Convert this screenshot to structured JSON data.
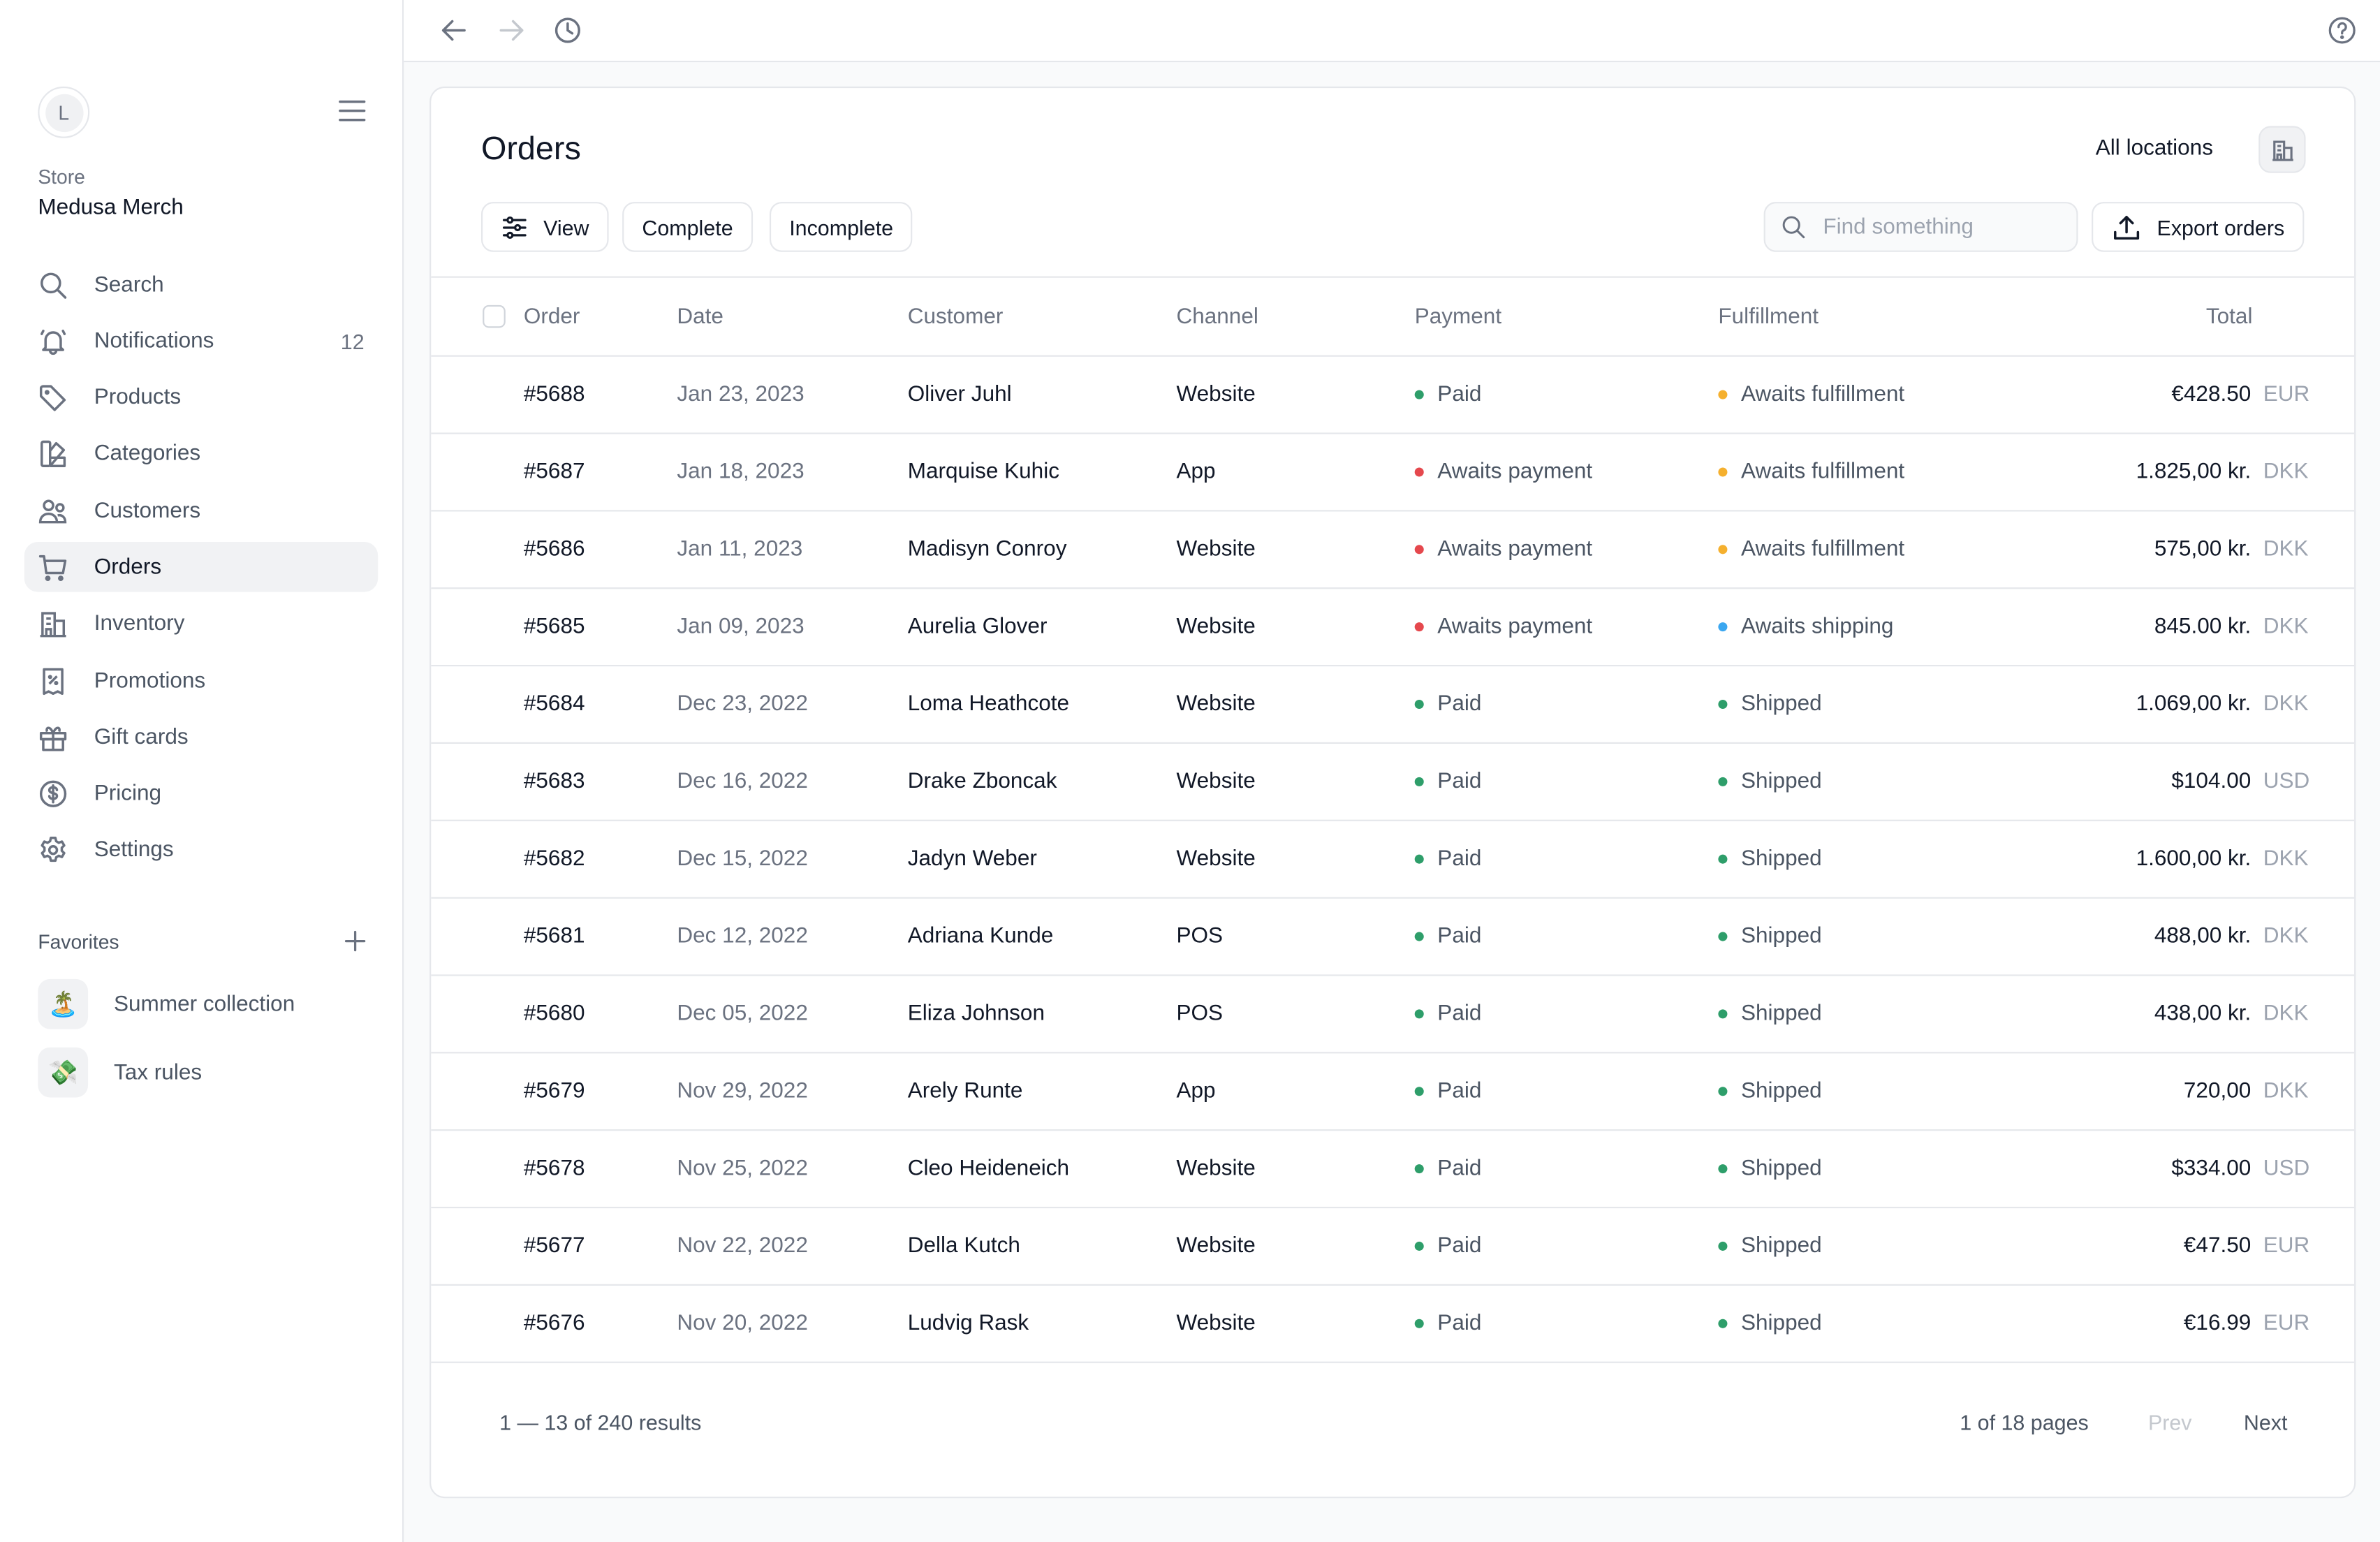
{
  "sidebar": {
    "avatar_initial": "L",
    "store_label": "Store",
    "store_name": "Medusa Merch",
    "items": [
      {
        "label": "Search",
        "icon": "search-icon"
      },
      {
        "label": "Notifications",
        "icon": "bell-icon",
        "count": "12"
      },
      {
        "label": "Products",
        "icon": "tag-icon"
      },
      {
        "label": "Categories",
        "icon": "swatch-icon"
      },
      {
        "label": "Customers",
        "icon": "users-icon"
      },
      {
        "label": "Orders",
        "icon": "cart-icon",
        "active": true
      },
      {
        "label": "Inventory",
        "icon": "building-icon"
      },
      {
        "label": "Promotions",
        "icon": "receipt-percent-icon"
      },
      {
        "label": "Gift cards",
        "icon": "gift-icon"
      },
      {
        "label": "Pricing",
        "icon": "dollar-circle-icon"
      },
      {
        "label": "Settings",
        "icon": "gear-icon"
      }
    ],
    "favorites_label": "Favorites",
    "favorites": [
      {
        "label": "Summer collection",
        "emoji": "🏝️"
      },
      {
        "label": "Tax rules",
        "emoji": "💸"
      }
    ]
  },
  "topbar": {
    "back_icon": "arrow-left-icon",
    "forward_icon": "arrow-right-icon",
    "history_icon": "clock-icon",
    "help_icon": "help-circle-icon"
  },
  "page": {
    "title": "Orders",
    "location_label": "All locations",
    "view_label": "View",
    "filter_complete": "Complete",
    "filter_incomplete": "Incomplete",
    "search_placeholder": "Find something",
    "search_value": "",
    "export_label": "Export orders"
  },
  "colors": {
    "paid": "#2e9e6a",
    "awaits_payment": "#e5484d",
    "awaits_fulfillment": "#f5b02e",
    "awaits_shipping": "#3ba7f0",
    "shipped": "#2e9e6a"
  },
  "table": {
    "columns": [
      "Order",
      "Date",
      "Customer",
      "Channel",
      "Payment",
      "Fulfillment",
      "Total"
    ],
    "rows": [
      {
        "order": "#5688",
        "date": "Jan 23, 2023",
        "customer": "Oliver Juhl",
        "channel": "Website",
        "payment": "Paid",
        "payment_color": "#2e9e6a",
        "fulfillment": "Awaits fulfillment",
        "fulfillment_color": "#f5b02e",
        "amount": "€428.50",
        "currency": "EUR"
      },
      {
        "order": "#5687",
        "date": "Jan 18, 2023",
        "customer": "Marquise Kuhic",
        "channel": "App",
        "payment": "Awaits payment",
        "payment_color": "#e5484d",
        "fulfillment": "Awaits fulfillment",
        "fulfillment_color": "#f5b02e",
        "amount": "1.825,00 kr.",
        "currency": "DKK"
      },
      {
        "order": "#5686",
        "date": "Jan 11, 2023",
        "customer": "Madisyn Conroy",
        "channel": "Website",
        "payment": "Awaits payment",
        "payment_color": "#e5484d",
        "fulfillment": "Awaits fulfillment",
        "fulfillment_color": "#f5b02e",
        "amount": "575,00 kr.",
        "currency": "DKK"
      },
      {
        "order": "#5685",
        "date": "Jan 09, 2023",
        "customer": "Aurelia Glover",
        "channel": "Website",
        "payment": "Awaits payment",
        "payment_color": "#e5484d",
        "fulfillment": "Awaits shipping",
        "fulfillment_color": "#3ba7f0",
        "amount": "845.00 kr.",
        "currency": "DKK"
      },
      {
        "order": "#5684",
        "date": "Dec 23, 2022",
        "customer": "Loma Heathcote",
        "channel": "Website",
        "payment": "Paid",
        "payment_color": "#2e9e6a",
        "fulfillment": "Shipped",
        "fulfillment_color": "#2e9e6a",
        "amount": "1.069,00 kr.",
        "currency": "DKK"
      },
      {
        "order": "#5683",
        "date": "Dec 16, 2022",
        "customer": "Drake Zboncak",
        "channel": "Website",
        "payment": "Paid",
        "payment_color": "#2e9e6a",
        "fulfillment": "Shipped",
        "fulfillment_color": "#2e9e6a",
        "amount": "$104.00",
        "currency": "USD"
      },
      {
        "order": "#5682",
        "date": "Dec 15, 2022",
        "customer": "Jadyn Weber",
        "channel": "Website",
        "payment": "Paid",
        "payment_color": "#2e9e6a",
        "fulfillment": "Shipped",
        "fulfillment_color": "#2e9e6a",
        "amount": "1.600,00 kr.",
        "currency": "DKK"
      },
      {
        "order": "#5681",
        "date": "Dec 12, 2022",
        "customer": "Adriana Kunde",
        "channel": "POS",
        "payment": "Paid",
        "payment_color": "#2e9e6a",
        "fulfillment": "Shipped",
        "fulfillment_color": "#2e9e6a",
        "amount": "488,00 kr.",
        "currency": "DKK"
      },
      {
        "order": "#5680",
        "date": "Dec 05, 2022",
        "customer": "Eliza Johnson",
        "channel": "POS",
        "payment": "Paid",
        "payment_color": "#2e9e6a",
        "fulfillment": "Shipped",
        "fulfillment_color": "#2e9e6a",
        "amount": "438,00 kr.",
        "currency": "DKK"
      },
      {
        "order": "#5679",
        "date": "Nov 29, 2022",
        "customer": "Arely Runte",
        "channel": "App",
        "payment": "Paid",
        "payment_color": "#2e9e6a",
        "fulfillment": "Shipped",
        "fulfillment_color": "#2e9e6a",
        "amount": "720,00",
        "currency": "DKK"
      },
      {
        "order": "#5678",
        "date": "Nov 25, 2022",
        "customer": "Cleo Heideneich",
        "channel": "Website",
        "payment": "Paid",
        "payment_color": "#2e9e6a",
        "fulfillment": "Shipped",
        "fulfillment_color": "#2e9e6a",
        "amount": "$334.00",
        "currency": "USD"
      },
      {
        "order": "#5677",
        "date": "Nov 22, 2022",
        "customer": "Della Kutch",
        "channel": "Website",
        "payment": "Paid",
        "payment_color": "#2e9e6a",
        "fulfillment": "Shipped",
        "fulfillment_color": "#2e9e6a",
        "amount": "€47.50",
        "currency": "EUR"
      },
      {
        "order": "#5676",
        "date": "Nov 20, 2022",
        "customer": "Ludvig Rask",
        "channel": "Website",
        "payment": "Paid",
        "payment_color": "#2e9e6a",
        "fulfillment": "Shipped",
        "fulfillment_color": "#2e9e6a",
        "amount": "€16.99",
        "currency": "EUR"
      }
    ]
  },
  "pagination": {
    "results": "1 — 13 of 240 results",
    "pages": "1 of 18 pages",
    "prev_label": "Prev",
    "next_label": "Next"
  }
}
